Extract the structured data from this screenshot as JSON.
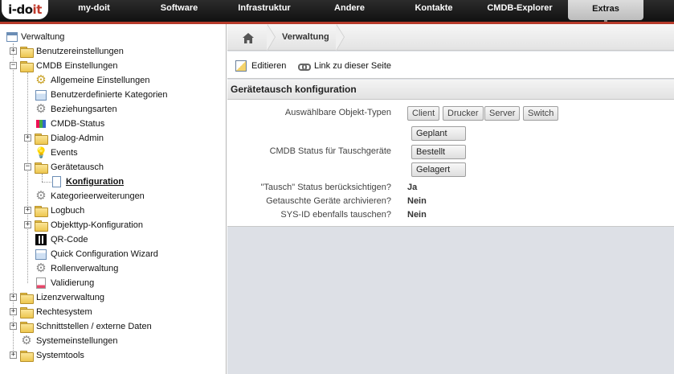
{
  "app": {
    "logo_text_a": "i-do",
    "logo_text_b": "it"
  },
  "nav": {
    "items": [
      "my-doit",
      "Software",
      "Infrastruktur",
      "Andere",
      "Kontakte",
      "CMDB-Explorer",
      "Extras"
    ],
    "active": "Extras"
  },
  "tree": {
    "root": "Verwaltung",
    "items": [
      "Benutzereinstellungen",
      "CMDB Einstellungen",
      "Allgemeine Einstellungen",
      "Benutzerdefinierte Kategorien",
      "Beziehungsarten",
      "CMDB-Status",
      "Dialog-Admin",
      "Events",
      "Gerätetausch",
      "Konfiguration",
      "Kategorieerweiterungen",
      "Logbuch",
      "Objekttyp-Konfiguration",
      "QR-Code",
      "Quick Configuration Wizard",
      "Rollenverwaltung",
      "Validierung",
      "Lizenzverwaltung",
      "Rechtesystem",
      "Schnittstellen / externe Daten",
      "Systemeinstellungen",
      "Systemtools"
    ]
  },
  "breadcrumb": {
    "current": "Verwaltung"
  },
  "toolbar": {
    "edit_label": "Editieren",
    "link_label": "Link zu dieser Seite"
  },
  "panel": {
    "title": "Gerätetausch konfiguration",
    "object_types_label": "Auswählbare Objekt-Typen",
    "object_types": [
      "Client",
      "Drucker",
      "Server",
      "Switch"
    ],
    "status_label": "CMDB Status für Tauschgeräte",
    "statuses": [
      "Geplant",
      "Bestellt",
      "Gelagert"
    ],
    "consider_status_label": "\"Tausch\" Status berücksichtigen?",
    "consider_status_value": "Ja",
    "archive_label": "Getauschte Geräte archivieren?",
    "archive_value": "Nein",
    "sysid_label": "SYS-ID ebenfalls tauschen?",
    "sysid_value": "Nein"
  }
}
